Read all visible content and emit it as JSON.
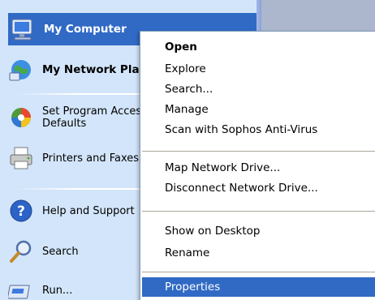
{
  "start_menu": {
    "items": [
      {
        "label": "My Computer",
        "icon": "my-computer-icon"
      },
      {
        "label": "My Network Places",
        "icon": "my-network-places-icon"
      },
      {
        "label": "Set Program Access and Defaults",
        "icon": "set-program-defaults-icon"
      },
      {
        "label": "Printers and Faxes",
        "icon": "printer-icon"
      },
      {
        "label": "Help and Support",
        "icon": "help-icon"
      },
      {
        "label": "Search",
        "icon": "search-icon"
      },
      {
        "label": "Run...",
        "icon": "run-icon"
      }
    ]
  },
  "context_menu": {
    "items": [
      {
        "label": "Open"
      },
      {
        "label": "Explore"
      },
      {
        "label": "Search..."
      },
      {
        "label": "Manage"
      },
      {
        "label": "Scan with Sophos Anti-Virus"
      },
      {
        "label": "Map Network Drive..."
      },
      {
        "label": "Disconnect Network Drive..."
      },
      {
        "label": "Show on Desktop"
      },
      {
        "label": "Rename"
      },
      {
        "label": "Properties"
      }
    ]
  },
  "colors": {
    "selection": "#316ac5",
    "menu_pane": "#d3e5fa",
    "context_bg": "#ffffff"
  }
}
